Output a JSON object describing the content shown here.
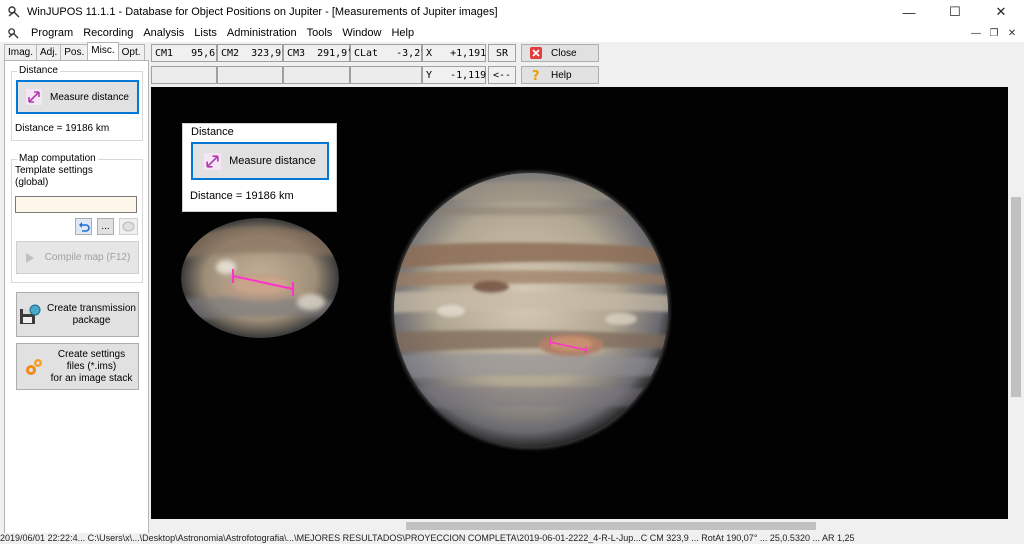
{
  "window": {
    "title": "WinJUPOS 11.1.1 - Database for Object Positions on Jupiter - [Measurements of Jupiter images]",
    "controls": [
      "—",
      "☐",
      "✕"
    ]
  },
  "menu": [
    "Program",
    "Recording",
    "Analysis",
    "Lists",
    "Administration",
    "Tools",
    "Window",
    "Help"
  ],
  "tabs": [
    "Imag.",
    "Adj.",
    "Pos.",
    "Misc.",
    "Opt."
  ],
  "active_tab": "Misc.",
  "distance": {
    "group_label": "Distance",
    "button": "Measure distance",
    "result": "Distance = 19186 km"
  },
  "map": {
    "group_label": "Map computation",
    "template_label": "Template settings",
    "template_sub": "(global)",
    "input_value": "",
    "dots_button": "...",
    "compile_button": "Compile map (F12)"
  },
  "transmission_button": [
    "Create transmission",
    "package"
  ],
  "settings_button": [
    "Create settings",
    "files (*.ims)",
    "for an image stack"
  ],
  "info": {
    "cm1": "CM1   95,6°",
    "cm2": "CM2  323,9°",
    "cm3": "CM3  291,9°",
    "clat": "CLat   -3,2°",
    "x": "X   +1,191",
    "y": "Y   -1,119",
    "sr": "SR",
    "back": "<--"
  },
  "close_button": "Close",
  "help_button": "Help",
  "overlay": {
    "group_label": "Distance",
    "button": "Measure distance",
    "result": "Distance = 19186 km"
  },
  "status": "2019/06/01  22:22:4...   C:\\Users\\x\\...\\Desktop\\Astronomia\\Astrofotografia\\...\\MEJORES RESULTADOS\\PROYECCION COMPLETA\\2019-06-01-2222_4-R-L-Jup...C  CM 323,9  ...  RotAt 190,07°  ...  25,0.5320 ... AR 1,25",
  "colors": {
    "accent": "#0078d7",
    "measure_line": "#ff33cc"
  }
}
